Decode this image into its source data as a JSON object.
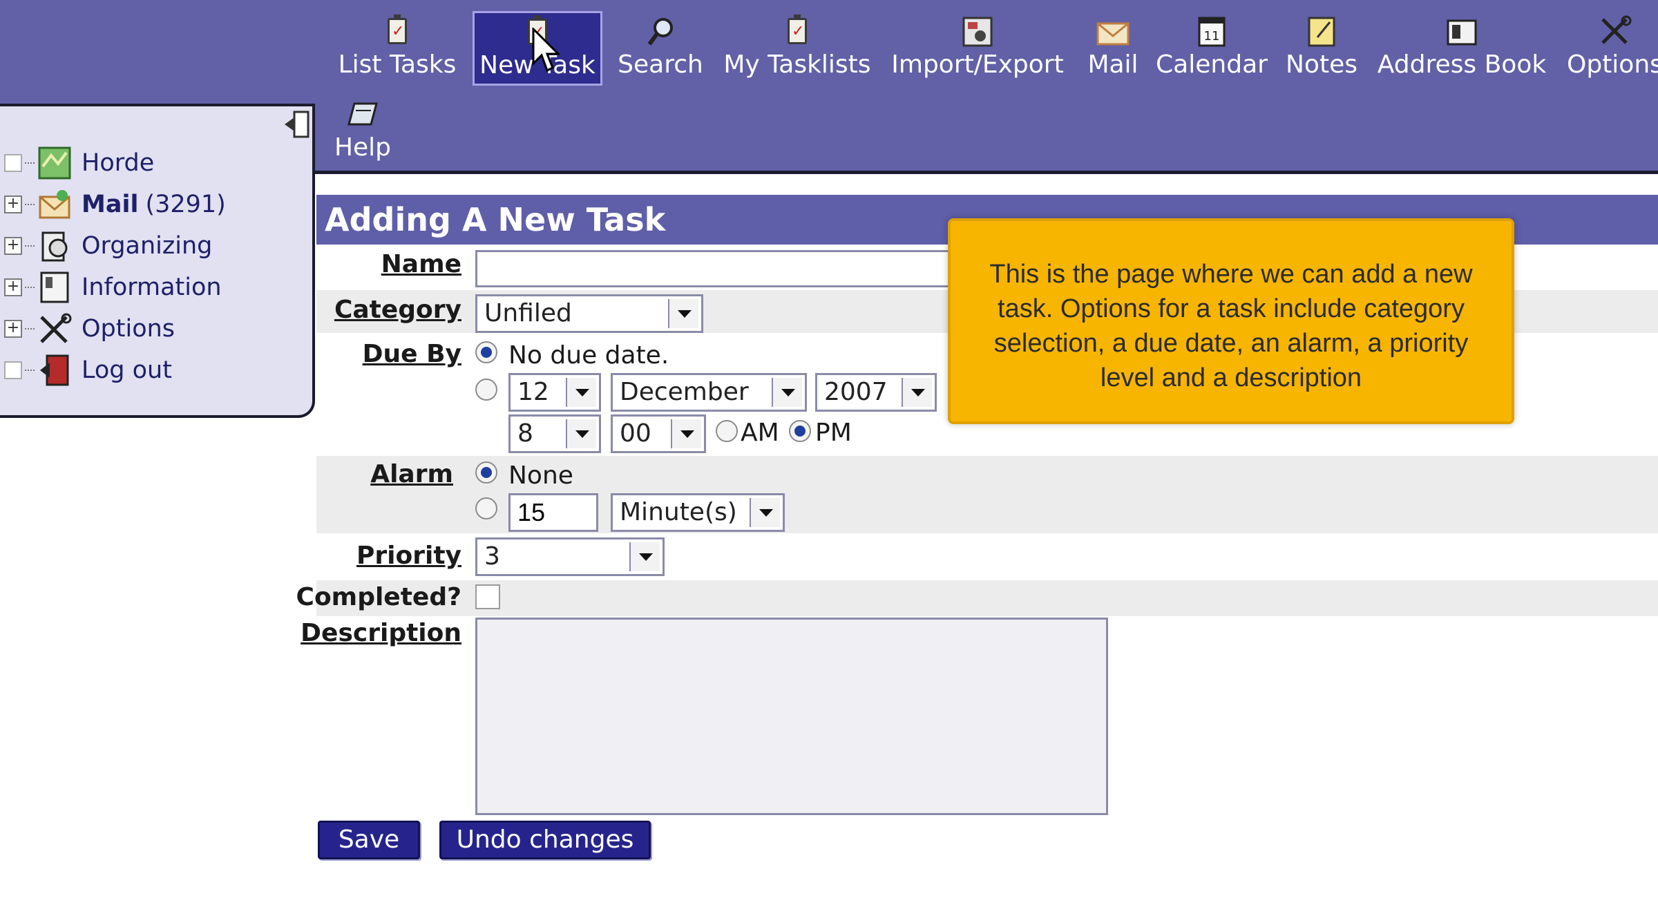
{
  "toolbar": {
    "items": [
      {
        "label": "List Tasks",
        "icon": "list-tasks-icon"
      },
      {
        "label": "New Task",
        "icon": "new-task-icon",
        "active": true
      },
      {
        "label": "Search",
        "icon": "search-icon"
      },
      {
        "label": "My Tasklists",
        "icon": "tasklists-icon"
      },
      {
        "label": "Import/Export",
        "icon": "import-export-icon"
      },
      {
        "label": "Mail",
        "icon": "mail-icon"
      },
      {
        "label": "Calendar",
        "icon": "calendar-icon"
      },
      {
        "label": "Notes",
        "icon": "notes-icon"
      },
      {
        "label": "Address Book",
        "icon": "address-book-icon"
      },
      {
        "label": "Options",
        "icon": "options-icon"
      },
      {
        "label": "Help",
        "icon": "help-icon"
      }
    ]
  },
  "sidebar": {
    "items": [
      {
        "label": "Horde",
        "icon": "horde-map-icon",
        "expandable": false
      },
      {
        "label": "Mail",
        "count": "(3291)",
        "icon": "mail-envelope-icon",
        "expandable": true,
        "bold": true
      },
      {
        "label": "Organizing",
        "icon": "organizing-icon",
        "expandable": true
      },
      {
        "label": "Information",
        "icon": "information-icon",
        "expandable": true
      },
      {
        "label": "Options",
        "icon": "options-tools-icon",
        "expandable": true
      },
      {
        "label": "Log out",
        "icon": "logout-icon",
        "expandable": false
      }
    ]
  },
  "form": {
    "title": "Adding A New Task",
    "name_label": "Name",
    "name_value": "",
    "category_label": "Category",
    "category_value": "Unfiled",
    "due_label": "Due By",
    "due_none_label": "No due date.",
    "due_day": "12",
    "due_month": "December",
    "due_year": "2007",
    "due_hour": "8",
    "due_minute": "00",
    "am_label": "AM",
    "pm_label": "PM",
    "alarm_label": "Alarm",
    "alarm_none_label": "None",
    "alarm_amount": "15",
    "alarm_unit": "Minute(s)",
    "priority_label": "Priority",
    "priority_value": "3",
    "completed_label": "Completed?",
    "description_label": "Description",
    "description_value": "",
    "save_label": "Save",
    "undo_label": "Undo changes"
  },
  "callout": {
    "text": "This is the page where we can add a new task.  Options for a task include category selection, a due date, an alarm, a priority level and a description"
  },
  "colors": {
    "header_purple": "#6260a6",
    "title_bar": "#5f5ea8",
    "button_blue": "#26248c",
    "callout_yellow": "#f7b500"
  }
}
